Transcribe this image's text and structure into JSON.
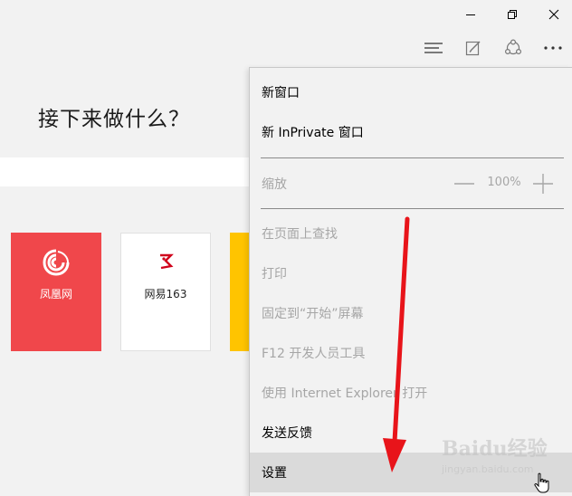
{
  "window": {
    "minimize_icon": "minimize-icon",
    "restore_icon": "restore-icon",
    "close_icon": "close-icon"
  },
  "toolbar": {
    "hub_icon": "hub-icon",
    "note_icon": "web-note-icon",
    "share_icon": "share-icon",
    "more_icon": "more-icon"
  },
  "newtab": {
    "heading": "接下来做什么？",
    "tiles": [
      {
        "label": "凤凰网",
        "color": "#f0474b",
        "icon": "ifeng-logo-icon"
      },
      {
        "label": "网易163",
        "color": "#ffffff",
        "icon": "netease-logo-icon"
      },
      {
        "label": "",
        "color": "#ffc400"
      }
    ]
  },
  "menu": {
    "new_window": "新窗口",
    "new_inprivate": "新 InPrivate 窗口",
    "zoom_label": "缩放",
    "zoom_value": "100%",
    "find_on_page": "在页面上查找",
    "print": "打印",
    "pin_to_start": "固定到“开始”屏幕",
    "f12_tools": "F12 开发人员工具",
    "open_with_ie": "使用 Internet Explorer 打开",
    "send_feedback": "发送反馈",
    "settings": "设置"
  },
  "annotation": {
    "arrow_color": "#e8141a"
  },
  "watermark": {
    "brand": "Baidu经验",
    "url": "jingyan.baidu.com"
  }
}
